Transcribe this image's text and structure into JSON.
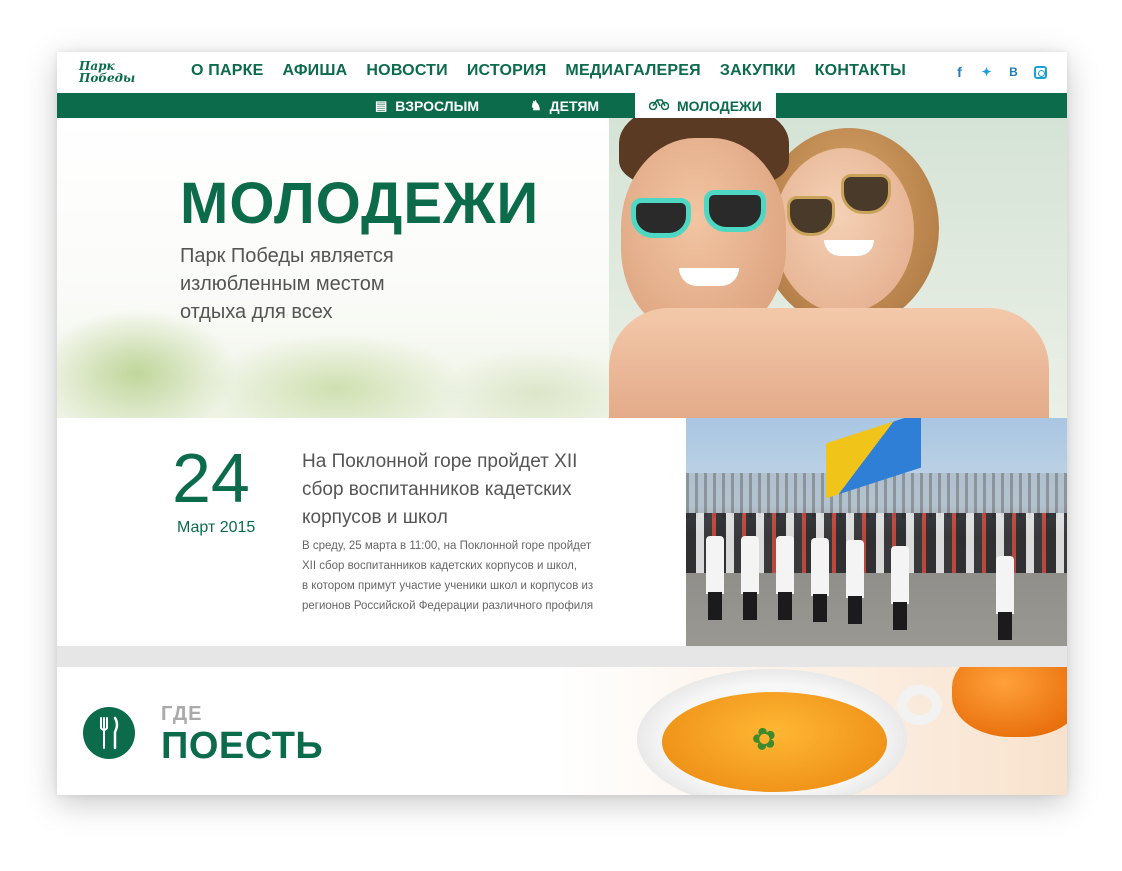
{
  "logo": {
    "line1": "Парк",
    "line2": "Победы"
  },
  "nav": {
    "items": [
      "О ПАРКЕ",
      "АФИША",
      "НОВОСТИ",
      "ИСТОРИЯ",
      "МЕДИАГАЛЕРЕЯ",
      "ЗАКУПКИ",
      "КОНТАКТЫ"
    ]
  },
  "social": {
    "facebook": "f",
    "twitter": "🐦",
    "vk": "B"
  },
  "subnav": {
    "adults": "ВЗРОСЛЫМ",
    "kids": "ДЕТЯМ",
    "youth": "МОЛОДЕЖИ",
    "active": "youth"
  },
  "hero": {
    "title": "МОЛОДЕЖИ",
    "subtitle": "Парк Победы является излюбленным местом отдыха для всех"
  },
  "news": {
    "day": "24",
    "month": "Март 2015",
    "title": "На Поклонной горе пройдет XII сбор воспитанников кадетских корпусов и школ",
    "text_lines": [
      "В среду, 25 марта в 11:00, на Поклонной горе пройдет",
      "XII сбор воспитанников кадетских корпусов и школ,",
      "в котором примут участие ученики школ и корпусов из",
      "регионов Российской Федерации различного профиля"
    ]
  },
  "food": {
    "small": "ГДЕ",
    "big": "ПОЕСТЬ"
  },
  "colors": {
    "brand_green": "#0c6b4a",
    "social_blue": "#1a7dc2"
  }
}
